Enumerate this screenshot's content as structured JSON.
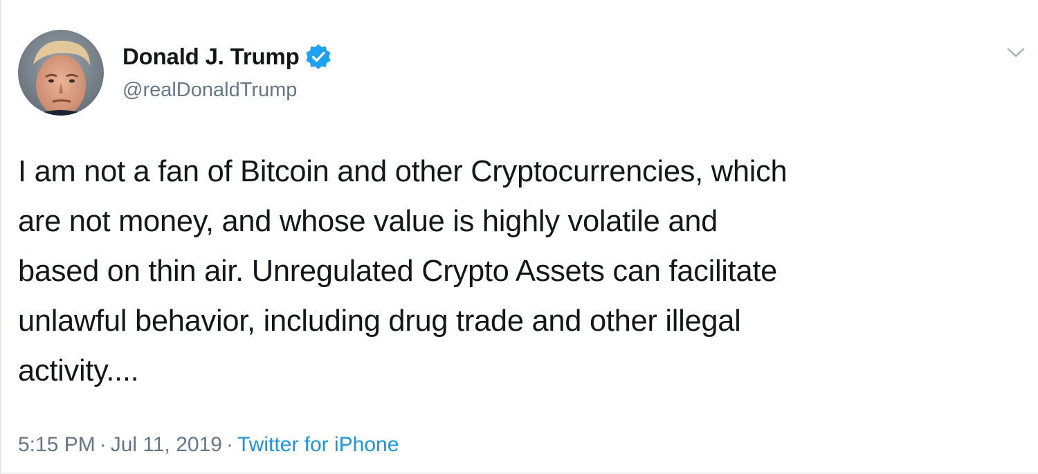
{
  "author": {
    "display_name": "Donald J. Trump",
    "handle": "@realDonaldTrump",
    "verified": true,
    "avatar_icon": "profile-photo"
  },
  "tweet": {
    "text": "I am not a fan of Bitcoin and other Cryptocurrencies, which\nare not money, and whose value is highly volatile and\nbased on thin air. Unregulated Crypto Assets can facilitate\nunlawful behavior, including drug trade and other illegal\nactivity....",
    "time": "5:15 PM",
    "separator": "·",
    "date": "Jul 11, 2019",
    "source": "Twitter for iPhone"
  },
  "icons": {
    "verified": "verified-badge-icon",
    "menu": "chevron-down-icon"
  },
  "colors": {
    "text": "#14171a",
    "secondary": "#657786",
    "link": "#1b95e0",
    "verified": "#1da1f2"
  }
}
